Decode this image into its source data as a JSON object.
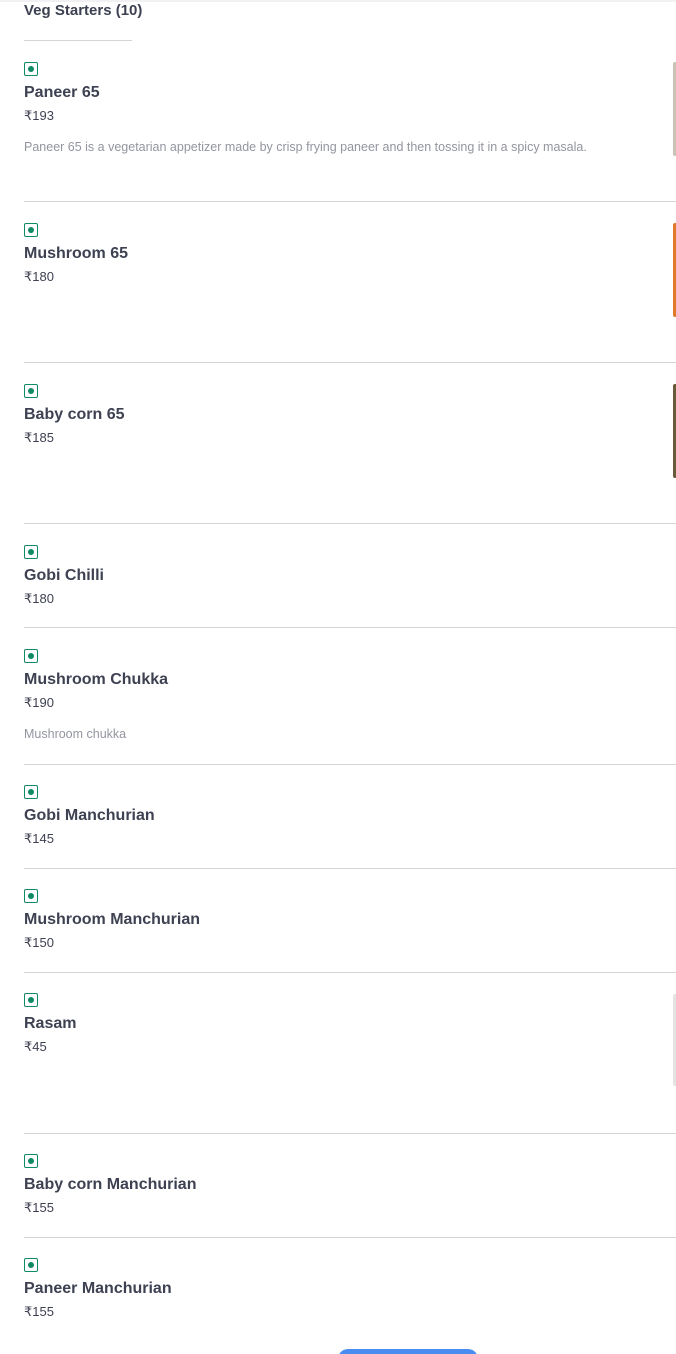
{
  "section": {
    "title": "Veg Starters (10)"
  },
  "colors": {
    "veg": "#0f8a65",
    "text": "#3e4152",
    "muted": "#93959f",
    "divider": "#d4d5d9"
  },
  "items": [
    {
      "name": "Paneer 65",
      "price": "₹193",
      "description": "Paneer 65 is a vegetarian appetizer made by crisp frying paneer and then tossing it in a spicy masala.",
      "veg": true
    },
    {
      "name": "Mushroom 65",
      "price": "₹180",
      "veg": true
    },
    {
      "name": "Baby corn 65",
      "price": "₹185",
      "veg": true
    },
    {
      "name": "Gobi Chilli",
      "price": "₹180",
      "veg": true
    },
    {
      "name": "Mushroom Chukka",
      "price": "₹190",
      "description": "Mushroom chukka",
      "veg": true
    },
    {
      "name": "Gobi Manchurian",
      "price": "₹145",
      "veg": true
    },
    {
      "name": "Mushroom Manchurian",
      "price": "₹150",
      "veg": true
    },
    {
      "name": "Rasam",
      "price": "₹45",
      "veg": true
    },
    {
      "name": "Baby corn Manchurian",
      "price": "₹155",
      "veg": true
    },
    {
      "name": "Paneer Manchurian",
      "price": "₹155",
      "veg": true
    }
  ]
}
